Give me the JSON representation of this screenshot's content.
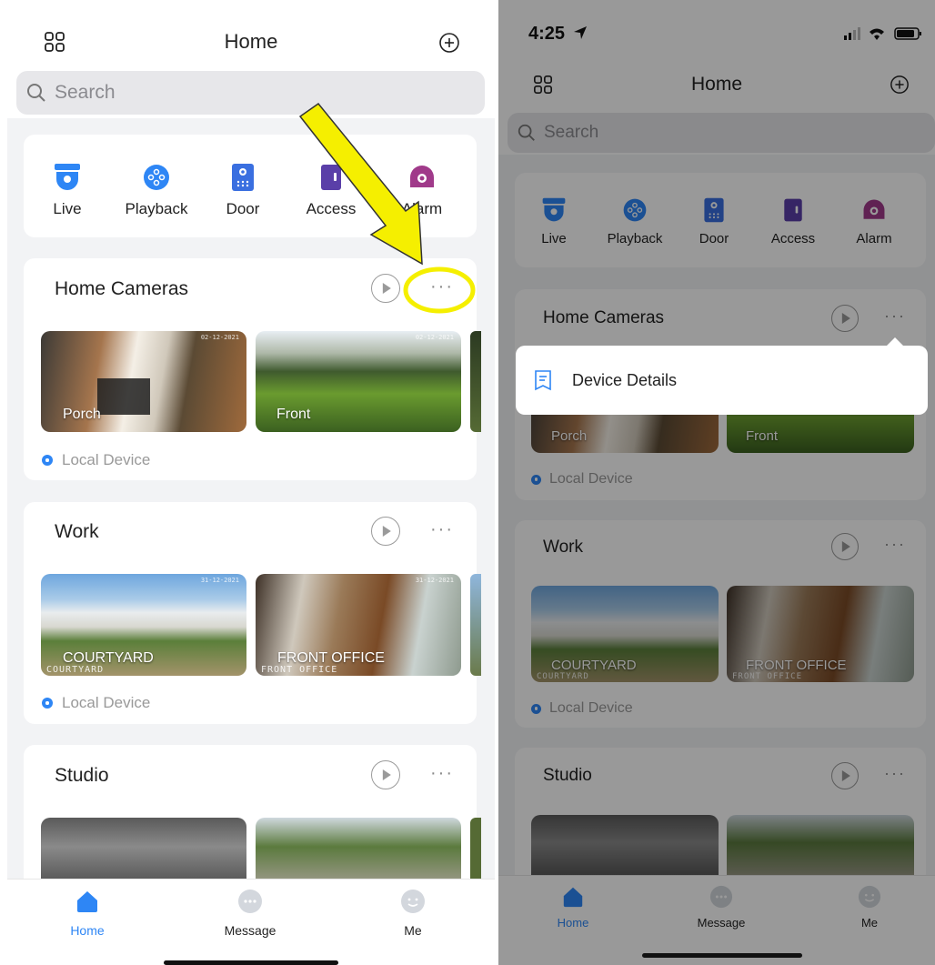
{
  "left": {
    "header": {
      "title": "Home"
    },
    "search": {
      "placeholder": "Search"
    },
    "shortcuts": [
      {
        "label": "Live",
        "color": "#2e86f5",
        "icon": "camera-dome-icon"
      },
      {
        "label": "Playback",
        "color": "#2e86f5",
        "icon": "playback-icon"
      },
      {
        "label": "Door",
        "color": "#3a6fe0",
        "icon": "door-intercom-icon"
      },
      {
        "label": "Access",
        "color": "#5a3fa8",
        "icon": "access-control-icon"
      },
      {
        "label": "Alarm",
        "color": "#a03a8a",
        "icon": "alarm-icon"
      }
    ],
    "groups": [
      {
        "title": "Home Cameras",
        "cameras": [
          {
            "label": "Porch"
          },
          {
            "label": "Front"
          }
        ],
        "device": "Local Device"
      },
      {
        "title": "Work",
        "cameras": [
          {
            "label": "COURTYARD",
            "sub": "COURTYARD"
          },
          {
            "label": "FRONT OFFICE",
            "sub": "FRONT OFFICE"
          }
        ],
        "device": "Local Device"
      },
      {
        "title": "Studio"
      }
    ],
    "tabs": [
      {
        "label": "Home"
      },
      {
        "label": "Message"
      },
      {
        "label": "Me"
      }
    ]
  },
  "right": {
    "status": {
      "time": "4:25"
    },
    "header": {
      "title": "Home"
    },
    "search": {
      "placeholder": "Search"
    },
    "shortcuts": [
      {
        "label": "Live"
      },
      {
        "label": "Playback"
      },
      {
        "label": "Door"
      },
      {
        "label": "Access"
      },
      {
        "label": "Alarm"
      }
    ],
    "groups": [
      {
        "title": "Home Cameras",
        "cameras": [
          {
            "label": "Porch"
          },
          {
            "label": "Front"
          }
        ],
        "device": "Local Device"
      },
      {
        "title": "Work",
        "cameras": [
          {
            "label": "COURTYARD",
            "sub": "COURTYARD"
          },
          {
            "label": "FRONT OFFICE",
            "sub": "FRONT OFFICE"
          }
        ],
        "device": "Local Device"
      },
      {
        "title": "Studio"
      }
    ],
    "popup": {
      "item": "Device Details"
    },
    "tabs": [
      {
        "label": "Home"
      },
      {
        "label": "Message"
      },
      {
        "label": "Me"
      }
    ]
  },
  "annotation": {
    "arrow_color": "#f5ef00"
  },
  "colors": {
    "accent": "#2e86f5"
  }
}
